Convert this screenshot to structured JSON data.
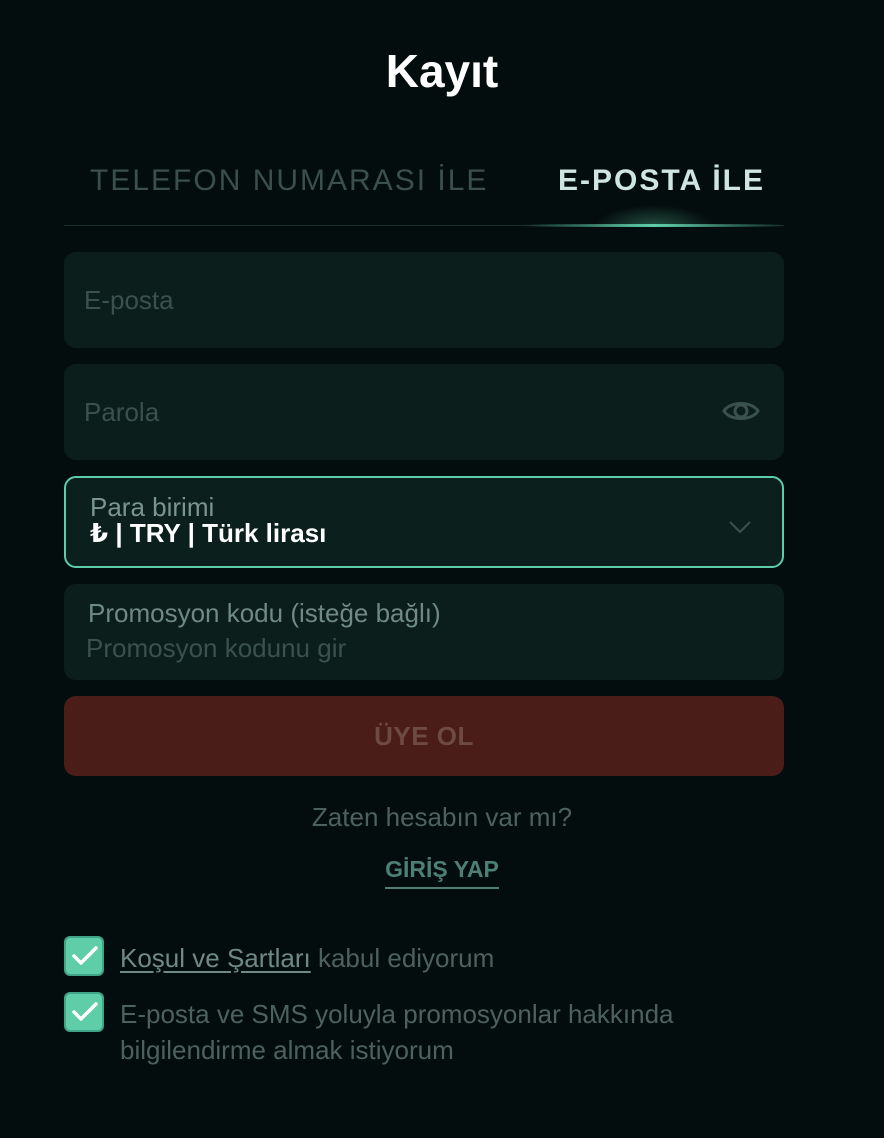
{
  "page": {
    "title": "Kayıt"
  },
  "tabs": [
    {
      "label": "TELEFON NUMARASI İLE",
      "active": false
    },
    {
      "label": "E-POSTA İLE",
      "active": true
    }
  ],
  "form": {
    "email": {
      "value": "",
      "placeholder": "E-posta"
    },
    "password": {
      "value": "",
      "placeholder": "Parola",
      "icon": "eye-icon"
    },
    "currency": {
      "label": "Para birimi",
      "value": "₺ | TRY | Türk lirası",
      "icon": "chevron-down-icon"
    },
    "promo": {
      "label": "Promosyon kodu (isteğe bağlı)",
      "value": "",
      "placeholder": "Promosyon kodunu gir"
    },
    "submit_label": "ÜYE OL"
  },
  "login": {
    "question": "Zaten hesabın var mı?",
    "link_label": "GİRİŞ YAP"
  },
  "consents": {
    "terms": {
      "checked": true,
      "link_text": "Koşul ve Şartları",
      "text": " kabul ediyorum"
    },
    "marketing": {
      "checked": true,
      "text": "E-posta ve SMS yoluyla promosyonlar hakkında bilgilendirme almak istiyorum"
    }
  },
  "colors": {
    "background": "#040d0d",
    "accent": "#5ecda8",
    "field_bg": "#0b1e1c",
    "button_bg": "#4a1d18"
  }
}
